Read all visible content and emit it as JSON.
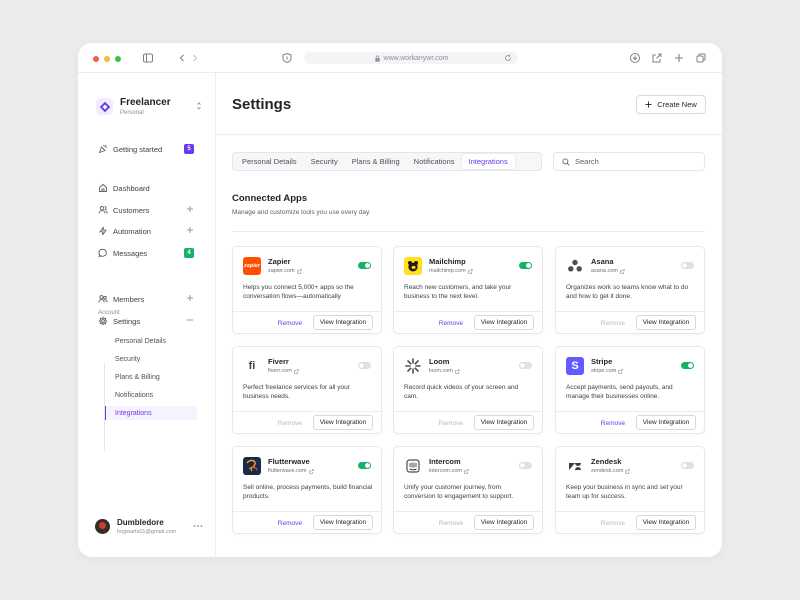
{
  "browser": {
    "url": "www.workanywr.com"
  },
  "workspace": {
    "name": "Freelancer",
    "subtitle": "Personal"
  },
  "sidebar": {
    "getting_started": {
      "label": "Getting started",
      "badge": "5"
    },
    "items": [
      {
        "label": "Dashboard",
        "icon": "home-icon"
      },
      {
        "label": "Customers",
        "icon": "users-icon"
      },
      {
        "label": "Automation",
        "icon": "automation-icon"
      },
      {
        "label": "Messages",
        "icon": "message-icon",
        "badge": "4"
      }
    ],
    "account_label": "Account",
    "account_items": [
      {
        "label": "Members",
        "icon": "members-icon"
      },
      {
        "label": "Settings",
        "icon": "gear-icon"
      }
    ],
    "settings_sub": [
      {
        "label": "Personal Details"
      },
      {
        "label": "Security"
      },
      {
        "label": "Plans & Billing"
      },
      {
        "label": "Notifications"
      },
      {
        "label": "Integrations",
        "active": true
      }
    ]
  },
  "user": {
    "name": "Dumbledore",
    "email": "hogwarts01@gmail.com"
  },
  "header": {
    "title": "Settings",
    "create_label": "Create New"
  },
  "tabs": [
    {
      "label": "Personal Details"
    },
    {
      "label": "Security"
    },
    {
      "label": "Plans & Billing"
    },
    {
      "label": "Notifications"
    },
    {
      "label": "Integrations",
      "active": true
    }
  ],
  "search": {
    "placeholder": "Search"
  },
  "section": {
    "title": "Connected Apps",
    "description": "Manage and customize tools you use every day."
  },
  "colors": {
    "accent": "#6938ef",
    "toggle_on": "#17b26a"
  },
  "apps": [
    {
      "name": "Zapier",
      "url": "zapier.com",
      "enabled": true,
      "description": "Helps you connect 5,000+ apps so the conversation flows—automatically",
      "remove": "Remove",
      "view": "View Integration",
      "logo": "zapier-logo",
      "logo_text": "zapier",
      "logo_color": "#ff4f00"
    },
    {
      "name": "Mailchimp",
      "url": "mailchimp.com",
      "enabled": true,
      "description": "Reach new customers, and take your business to the next level.",
      "remove": "Remove",
      "view": "View Integration",
      "logo": "mailchimp-logo",
      "logo_color": "#ffe01b"
    },
    {
      "name": "Asana",
      "url": "asana.com",
      "enabled": false,
      "description": "Organizes work so teams know what to do and how to get it done.",
      "remove": "Remove",
      "view": "View Integration",
      "logo": "asana-logo",
      "logo_color": "#4a4f59"
    },
    {
      "name": "Fiverr",
      "url": "fiverr.com",
      "enabled": false,
      "description": "Perfect freelance services for all your business needs.",
      "remove": "Remove",
      "view": "View Integration",
      "logo": "fiverr-logo",
      "logo_text": "fi",
      "logo_color": "#404145"
    },
    {
      "name": "Loom",
      "url": "loom.com",
      "enabled": false,
      "description": "Record quick videos of your screen and cam.",
      "remove": "Remove",
      "view": "View Integration",
      "logo": "loom-logo",
      "logo_color": "#625df5"
    },
    {
      "name": "Stripe",
      "url": "stripe.com",
      "enabled": true,
      "description": "Accept payments, send payouts, and manage their businesses online.",
      "remove": "Remove",
      "view": "View Integration",
      "logo": "stripe-logo",
      "logo_text": "S",
      "logo_color": "#635bff"
    },
    {
      "name": "Flutterwave",
      "url": "flutterwave.com",
      "enabled": true,
      "description": "Sell online, process payments, build financial products.",
      "remove": "Remove",
      "view": "View Integration",
      "logo": "flutterwave-logo",
      "logo_color": "#1b2a4a"
    },
    {
      "name": "Intercom",
      "url": "intercom.com",
      "enabled": false,
      "description": "Unify your customer journey, from conversion to engagement to support.",
      "remove": "Remove",
      "view": "View Integration",
      "logo": "intercom-logo",
      "logo_color": "#4a4f59"
    },
    {
      "name": "Zendesk",
      "url": "zendesk.com",
      "enabled": false,
      "description": "Keep your business in sync and set your team up for success.",
      "remove": "Remove",
      "view": "View Integration",
      "logo": "zendesk-logo",
      "logo_color": "#3a3f47"
    }
  ]
}
